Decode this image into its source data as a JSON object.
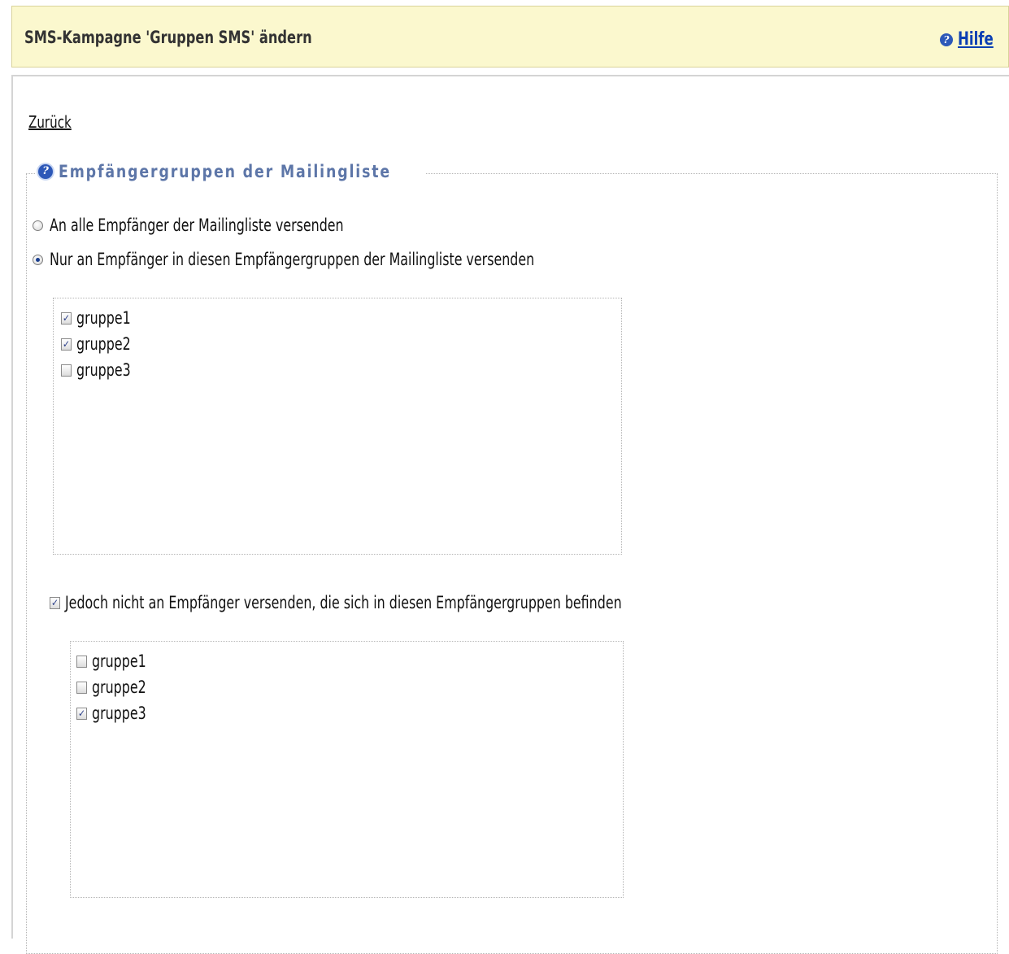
{
  "header": {
    "title": "SMS-Kampagne 'Gruppen SMS' ändern",
    "help_icon": "help-icon",
    "help_label": "Hilfe"
  },
  "nav": {
    "back_label": "Zurück"
  },
  "fieldset": {
    "legend_icon": "help-icon",
    "legend": "Empfängergruppen der Mailingliste",
    "radio_all": {
      "label": "An alle Empfänger der Mailingliste versenden",
      "checked": false
    },
    "radio_groups": {
      "label": "Nur an Empfänger in diesen Empfängergruppen der Mailingliste versenden",
      "checked": true
    },
    "include_groups": [
      {
        "label": "gruppe1",
        "checked": true
      },
      {
        "label": "gruppe2",
        "checked": true
      },
      {
        "label": "gruppe3",
        "checked": false
      }
    ],
    "exclude_toggle": {
      "label": "Jedoch nicht an Empfänger versenden, die sich in diesen Empfängergruppen befinden",
      "checked": true
    },
    "exclude_groups": [
      {
        "label": "gruppe1",
        "checked": false
      },
      {
        "label": "gruppe2",
        "checked": false
      },
      {
        "label": "gruppe3",
        "checked": true
      }
    ]
  },
  "colors": {
    "header_bg": "#fbf8ce",
    "link": "#0b3fb3",
    "legend": "#5d76a8"
  }
}
